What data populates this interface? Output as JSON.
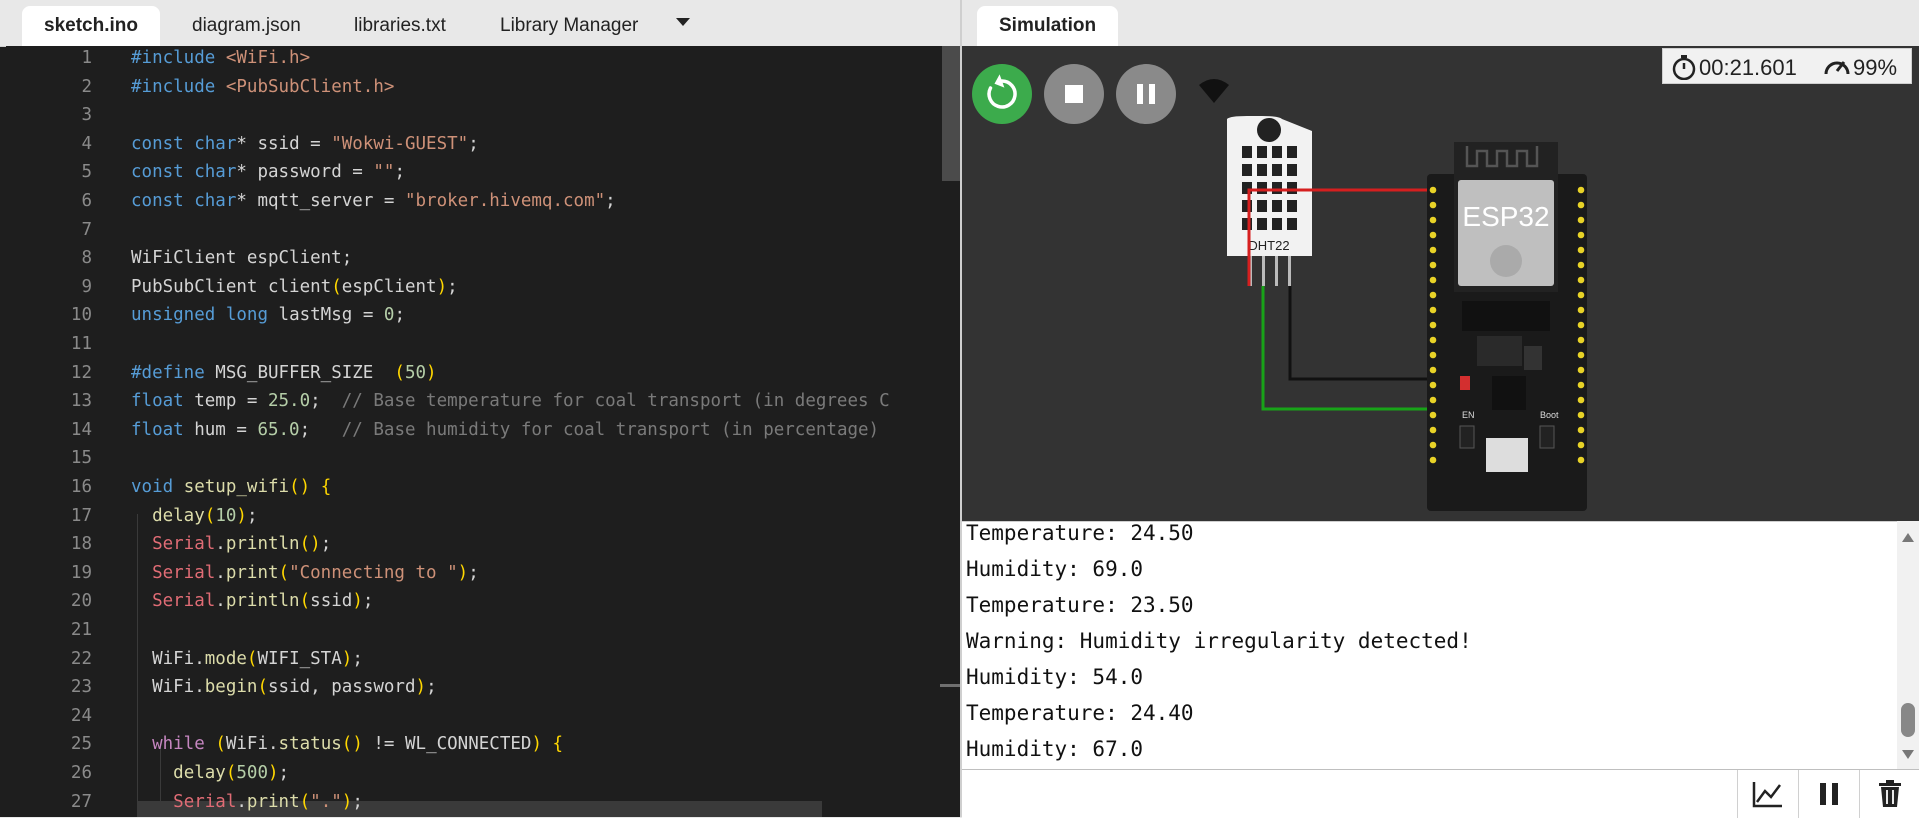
{
  "editor": {
    "tabs": [
      "sketch.ino",
      "diagram.json",
      "libraries.txt",
      "Library Manager"
    ],
    "line_numbers": [
      "1",
      "2",
      "3",
      "4",
      "5",
      "6",
      "7",
      "8",
      "9",
      "10",
      "11",
      "12",
      "13",
      "14",
      "15",
      "16",
      "17",
      "18",
      "19",
      "20",
      "21",
      "22",
      "23",
      "24",
      "25",
      "26",
      "27"
    ],
    "code_lines": [
      "#include <WiFi.h>",
      "#include <PubSubClient.h>",
      "",
      "const char* ssid = \"Wokwi-GUEST\";",
      "const char* password = \"\";",
      "const char* mqtt_server = \"broker.hivemq.com\";",
      "",
      "WiFiClient espClient;",
      "PubSubClient client(espClient);",
      "unsigned long lastMsg = 0;",
      "",
      "#define MSG_BUFFER_SIZE  (50)",
      "float temp = 25.0;  // Base temperature for coal transport (in degrees C",
      "float hum = 65.0;   // Base humidity for coal transport (in percentage)",
      "",
      "void setup_wifi() {",
      "  delay(10);",
      "  Serial.println();",
      "  Serial.print(\"Connecting to \");",
      "  Serial.println(ssid);",
      "",
      "  WiFi.mode(WIFI_STA);",
      "  WiFi.begin(ssid, password);",
      "",
      "  while (WiFi.status() != WL_CONNECTED) {",
      "    delay(500);",
      "    Serial.print(\".\");"
    ]
  },
  "simulation": {
    "tab_label": "Simulation",
    "timer": "00:21.601",
    "performance": "99%",
    "controls": {
      "restart": "restart-icon",
      "stop": "stop-icon",
      "pause": "pause-icon"
    },
    "wifi_icon": "wifi-icon",
    "parts": {
      "sensor_label": "DHT22",
      "board_label": "ESP32",
      "en_label": "EN",
      "boot_label": "Boot"
    }
  },
  "serial_monitor": {
    "lines": [
      "Temperature: 24.50",
      "Humidity: 69.0",
      "Temperature: 23.50",
      "Warning: Humidity irregularity detected!",
      "Humidity: 54.0",
      "Temperature: 24.40",
      "Humidity: 67.0"
    ],
    "input_value": "",
    "buttons": [
      "chart-icon",
      "pause-icon",
      "trash-icon"
    ]
  },
  "colors": {
    "accent_green": "#3cab4c",
    "editor_bg": "#1e1e1e",
    "canvas_bg": "#333333"
  }
}
